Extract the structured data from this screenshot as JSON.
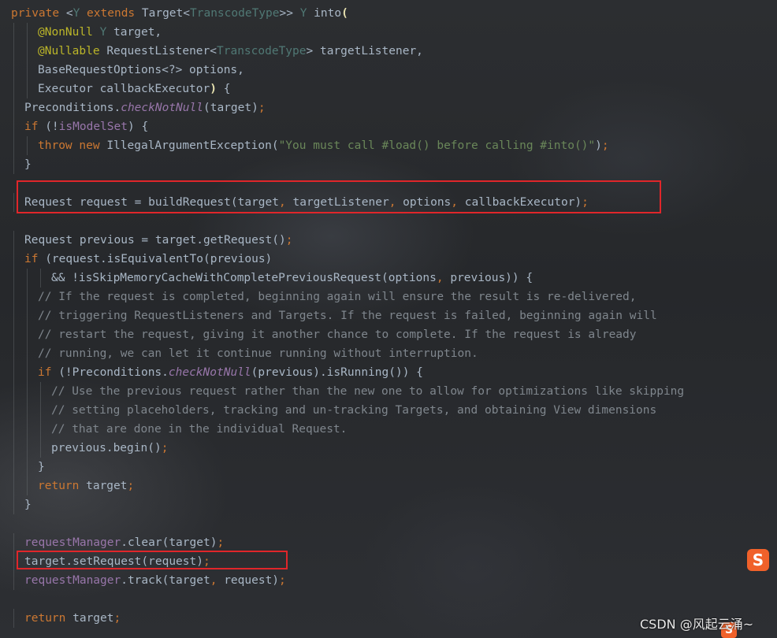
{
  "editor": {
    "lines": [
      {
        "indent": 0,
        "tokens": [
          [
            "kw",
            "private "
          ],
          [
            "fn",
            "<"
          ],
          [
            "tp",
            "Y"
          ],
          [
            "kw",
            " extends "
          ],
          [
            "fn",
            "Target<"
          ],
          [
            "tp",
            "TranscodeType"
          ],
          [
            "fn",
            ">> "
          ],
          [
            "tp",
            "Y"
          ],
          [
            "fn",
            " into"
          ],
          [
            "paren",
            "("
          ]
        ]
      },
      {
        "indent": 1,
        "tokens": [
          [
            "an",
            "@NonNull "
          ],
          [
            "tp",
            "Y"
          ],
          [
            "fn",
            " target,"
          ]
        ]
      },
      {
        "indent": 1,
        "tokens": [
          [
            "an",
            "@Nullable "
          ],
          [
            "fn",
            "RequestListener<"
          ],
          [
            "tp",
            "TranscodeType"
          ],
          [
            "fn",
            "> targetListener,"
          ]
        ]
      },
      {
        "indent": 1,
        "tokens": [
          [
            "fn",
            "BaseRequestOptions<?> options,"
          ]
        ]
      },
      {
        "indent": 1,
        "tokens": [
          [
            "fn",
            "Executor callbackExecutor"
          ],
          [
            "paren",
            ")"
          ],
          [
            "fn",
            " {"
          ]
        ]
      },
      {
        "indent": 0.5,
        "tokens": [
          [
            "fn",
            "Preconditions."
          ],
          [
            "mi",
            "checkNotNull"
          ],
          [
            "fn",
            "(target)"
          ],
          [
            "kw",
            ";"
          ]
        ]
      },
      {
        "indent": 0.5,
        "tokens": [
          [
            "kw",
            "if "
          ],
          [
            "fn",
            "(!"
          ],
          [
            "fd",
            "isModelSet"
          ],
          [
            "fn",
            ") {"
          ]
        ]
      },
      {
        "indent": 1,
        "tokens": [
          [
            "kw",
            "throw new "
          ],
          [
            "fn",
            "IllegalArgumentException("
          ],
          [
            "st",
            "\"You must call #load() before calling #into()\""
          ],
          [
            "fn",
            ")"
          ],
          [
            "kw",
            ";"
          ]
        ]
      },
      {
        "indent": 0.5,
        "tokens": [
          [
            "fn",
            "}"
          ]
        ]
      },
      {
        "indent": 0,
        "tokens": []
      },
      {
        "indent": 0.5,
        "tokens": [
          [
            "fn",
            "Request request = buildRequest(target"
          ],
          [
            "kw",
            ", "
          ],
          [
            "fn",
            "targetListener"
          ],
          [
            "kw",
            ", "
          ],
          [
            "fn",
            "options"
          ],
          [
            "kw",
            ", "
          ],
          [
            "fn",
            "callbackExecutor)"
          ],
          [
            "kw",
            ";"
          ]
        ]
      },
      {
        "indent": 0,
        "tokens": []
      },
      {
        "indent": 0.5,
        "tokens": [
          [
            "fn",
            "Request previous = target.getRequest()"
          ],
          [
            "kw",
            ";"
          ]
        ]
      },
      {
        "indent": 0.5,
        "tokens": [
          [
            "kw",
            "if "
          ],
          [
            "fn",
            "(request.isEquivalentTo(previous)"
          ]
        ]
      },
      {
        "indent": 1.5,
        "tokens": [
          [
            "fn",
            "&& !isSkipMemoryCacheWithCompletePreviousRequest(options"
          ],
          [
            "kw",
            ", "
          ],
          [
            "fn",
            "previous)) {"
          ]
        ]
      },
      {
        "indent": 1,
        "tokens": [
          [
            "cm",
            "// If the request is completed, beginning again will ensure the result is re-delivered,"
          ]
        ]
      },
      {
        "indent": 1,
        "tokens": [
          [
            "cm",
            "// triggering RequestListeners and Targets. If the request is failed, beginning again will"
          ]
        ]
      },
      {
        "indent": 1,
        "tokens": [
          [
            "cm",
            "// restart the request, giving it another chance to complete. If the request is already"
          ]
        ]
      },
      {
        "indent": 1,
        "tokens": [
          [
            "cm",
            "// running, we can let it continue running without interruption."
          ]
        ]
      },
      {
        "indent": 1,
        "tokens": [
          [
            "kw",
            "if "
          ],
          [
            "fn",
            "(!Preconditions."
          ],
          [
            "mi",
            "checkNotNull"
          ],
          [
            "fn",
            "(previous).isRunning()) {"
          ]
        ]
      },
      {
        "indent": 1.5,
        "tokens": [
          [
            "cm",
            "// Use the previous request rather than the new one to allow for optimizations like skipping"
          ]
        ]
      },
      {
        "indent": 1.5,
        "tokens": [
          [
            "cm",
            "// setting placeholders, tracking and un-tracking Targets, and obtaining View dimensions"
          ]
        ]
      },
      {
        "indent": 1.5,
        "tokens": [
          [
            "cm",
            "// that are done in the individual Request."
          ]
        ]
      },
      {
        "indent": 1.5,
        "tokens": [
          [
            "fn",
            "previous.begin()"
          ],
          [
            "kw",
            ";"
          ]
        ]
      },
      {
        "indent": 1,
        "tokens": [
          [
            "fn",
            "}"
          ]
        ]
      },
      {
        "indent": 1,
        "tokens": [
          [
            "kw",
            "return "
          ],
          [
            "fn",
            "target"
          ],
          [
            "kw",
            ";"
          ]
        ]
      },
      {
        "indent": 0.5,
        "tokens": [
          [
            "fn",
            "}"
          ]
        ]
      },
      {
        "indent": 0,
        "tokens": []
      },
      {
        "indent": 0.5,
        "tokens": [
          [
            "fd",
            "requestManager"
          ],
          [
            "fn",
            ".clear(target)"
          ],
          [
            "kw",
            ";"
          ]
        ]
      },
      {
        "indent": 0.5,
        "tokens": [
          [
            "fn",
            "target.setRequest(request)"
          ],
          [
            "kw",
            ";"
          ]
        ]
      },
      {
        "indent": 0.5,
        "tokens": [
          [
            "fd",
            "requestManager"
          ],
          [
            "fn",
            ".track(target"
          ],
          [
            "kw",
            ", "
          ],
          [
            "fn",
            "request)"
          ],
          [
            "kw",
            ";"
          ]
        ]
      },
      {
        "indent": 0,
        "tokens": []
      },
      {
        "indent": 0.5,
        "tokens": [
          [
            "kw",
            "return "
          ],
          [
            "fn",
            "target"
          ],
          [
            "kw",
            ";"
          ]
        ]
      }
    ]
  },
  "highlights": [
    {
      "label": "buildRequest line box"
    },
    {
      "label": "setRequest line box"
    }
  ],
  "ime_icon": "S",
  "watermark": "CSDN @风起云涌~",
  "colors": {
    "highlight": "#e0262a",
    "keyword": "#cc7832",
    "string": "#6a8759",
    "comment": "#7f868d",
    "field": "#9876aa",
    "annotation": "#bbb529"
  }
}
